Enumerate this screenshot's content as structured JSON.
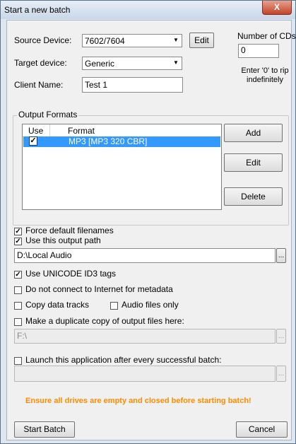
{
  "window": {
    "title": "Start a new batch",
    "close_label": "X"
  },
  "source_device": {
    "label": "Source Device:",
    "value": "7602/7604",
    "edit_label": "Edit"
  },
  "target_device": {
    "label": "Target device:",
    "value": "Generic"
  },
  "client_name": {
    "label": "Client Name:",
    "value": "Test 1"
  },
  "cd_count": {
    "label": "Number of CDs",
    "value": "0",
    "hint_line1": "Enter '0' to rip",
    "hint_line2": "indefinitely"
  },
  "output_formats": {
    "group_label": "Output Formats",
    "columns": [
      "Use",
      "Format"
    ],
    "rows": [
      {
        "use": true,
        "format": "MP3 [MP3 320 CBR]"
      }
    ],
    "add_label": "Add",
    "edit_label": "Edit",
    "delete_label": "Delete"
  },
  "options": {
    "force_default_filenames": {
      "label": "Force default filenames",
      "checked": true
    },
    "use_output_path": {
      "label": "Use this output path",
      "checked": true
    },
    "output_path": "D:\\Local Audio",
    "unicode_id3": {
      "label": "Use UNICODE ID3 tags",
      "checked": true
    },
    "no_internet": {
      "label": "Do not connect to Internet for metadata",
      "checked": false
    },
    "copy_data_tracks": {
      "label": "Copy data tracks",
      "checked": false
    },
    "audio_only": {
      "label": "Audio files only",
      "checked": false
    },
    "duplicate_copy": {
      "label": "Make a duplicate copy of output files here:",
      "checked": false
    },
    "duplicate_path": "F:\\",
    "launch_app": {
      "label": "Launch this application after every successful batch:",
      "checked": false
    },
    "launch_path": "",
    "browse_label": "..."
  },
  "warning": {
    "text": "Ensure all drives are empty and closed before starting batch!",
    "color": "#ff8c00"
  },
  "footer": {
    "start_label": "Start Batch",
    "cancel_label": "Cancel"
  },
  "colors": {
    "selection": "#3399ff",
    "close_button": "#c2452a"
  },
  "icons": {
    "dropdown": "chevron-down-icon",
    "check": "checkmark-icon"
  }
}
